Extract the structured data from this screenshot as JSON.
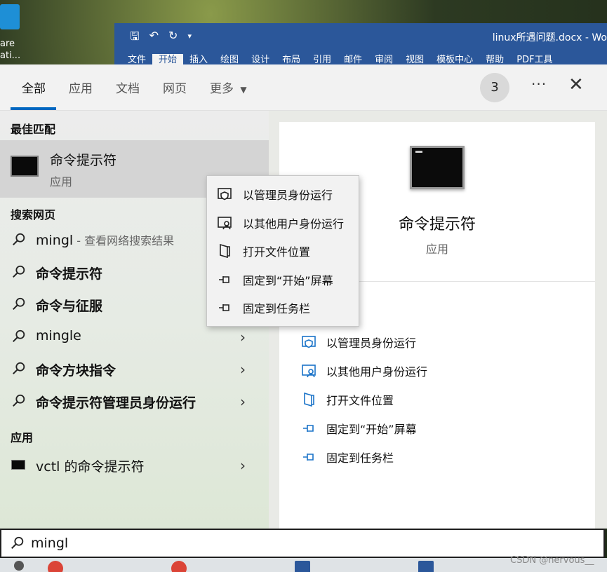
{
  "desktop": {
    "icon_label": "are\nati..."
  },
  "word": {
    "title": "linux所遇问题.docx  -  Wo",
    "tabs": [
      "文件",
      "开始",
      "插入",
      "绘图",
      "设计",
      "布局",
      "引用",
      "邮件",
      "审阅",
      "视图",
      "模板中心",
      "帮助",
      "PDF工具"
    ],
    "active_tab": "开始"
  },
  "search_panel": {
    "tabs": [
      "全部",
      "应用",
      "文档",
      "网页",
      "更多"
    ],
    "active_tab": "全部",
    "badge_count": "3",
    "more_dots": "···",
    "close": "✕"
  },
  "results": {
    "best_match_header": "最佳匹配",
    "best_match": {
      "title": "命令提示符",
      "subtitle": "应用"
    },
    "web_header": "搜索网页",
    "web_items": [
      {
        "text": "mingl",
        "sub": " - 查看网络搜索结果",
        "bold": false,
        "chevron": false
      },
      {
        "text": "命令提示符",
        "sub": "",
        "bold": true,
        "chevron": false
      },
      {
        "text": "命令与征服",
        "sub": "",
        "bold": true,
        "chevron": false
      },
      {
        "text": "mingle",
        "sub": "",
        "bold": false,
        "chevron": true
      },
      {
        "text": "命令方块指令",
        "sub": "",
        "bold": true,
        "chevron": true
      },
      {
        "text": "命令提示符管理员身份运行",
        "sub": "",
        "bold": true,
        "chevron": true
      }
    ],
    "apps_header": "应用",
    "app_items": [
      {
        "text": "vctl 的命令提示符",
        "chevron": true
      }
    ]
  },
  "detail": {
    "title": "命令提示符",
    "subtitle": "应用",
    "actions": [
      "以管理员身份运行",
      "以其他用户身份运行",
      "打开文件位置",
      "固定到“开始”屏幕",
      "固定到任务栏"
    ]
  },
  "context_menu": {
    "items": [
      "以管理员身份运行",
      "以其他用户身份运行",
      "打开文件位置",
      "固定到“开始”屏幕",
      "固定到任务栏"
    ]
  },
  "search_box": {
    "value": "mingl"
  },
  "watermark": "CSDN @nervous__",
  "colors": {
    "accent": "#0067c0",
    "word_blue": "#2b579a",
    "icon_blue": "#1a73c8"
  }
}
